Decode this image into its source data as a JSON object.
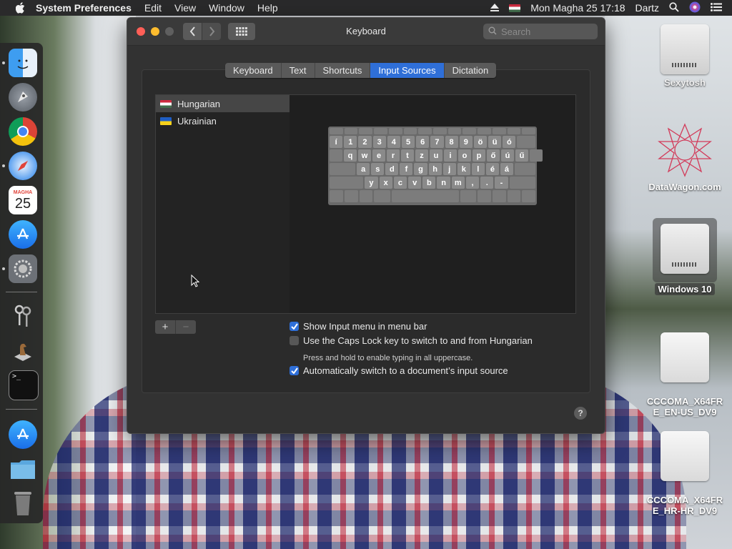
{
  "menubar": {
    "app": "System Preferences",
    "menus": [
      "Edit",
      "View",
      "Window",
      "Help"
    ],
    "datetime": "Mon Magha 25  17:18",
    "user": "Dartz"
  },
  "dock": {
    "calendar_month": "MAGHA",
    "calendar_day": "25"
  },
  "desktop_icons": [
    {
      "label": "Sexytosh"
    },
    {
      "label": "DataWagon.com"
    },
    {
      "label": "Windows 10"
    },
    {
      "label": "CCCOMA_X64FR\nE_EN-US_DV9"
    },
    {
      "label": "CCCOMA_X64FR\nE_HR-HR_DV9"
    }
  ],
  "window": {
    "title": "Keyboard",
    "search_placeholder": "Search",
    "tabs": [
      "Keyboard",
      "Text",
      "Shortcuts",
      "Input Sources",
      "Dictation"
    ],
    "active_tab": "Input Sources",
    "sources": [
      {
        "name": "Hungarian",
        "selected": true
      },
      {
        "name": "Ukrainian",
        "selected": false
      }
    ],
    "keyboard_rows": [
      [
        "í",
        "1",
        "2",
        "3",
        "4",
        "5",
        "6",
        "7",
        "8",
        "9",
        "ö",
        "ü",
        "ó"
      ],
      [
        "q",
        "w",
        "e",
        "r",
        "t",
        "z",
        "u",
        "i",
        "o",
        "p",
        "ő",
        "ú",
        "ű"
      ],
      [
        "a",
        "s",
        "d",
        "f",
        "g",
        "h",
        "j",
        "k",
        "l",
        "é",
        "á"
      ],
      [
        "y",
        "x",
        "c",
        "v",
        "b",
        "n",
        "m",
        ",",
        ".",
        "-"
      ]
    ],
    "options": {
      "show_input_menu": {
        "label": "Show Input menu in menu bar",
        "checked": true
      },
      "caps_lock": {
        "label": "Use the Caps Lock key to switch to and from Hungarian",
        "checked": false
      },
      "caps_hint": "Press and hold to enable typing in all uppercase.",
      "auto_switch": {
        "label": "Automatically switch to a document’s input source",
        "checked": true
      }
    },
    "add_label": "+",
    "remove_label": "−",
    "help_label": "?"
  }
}
